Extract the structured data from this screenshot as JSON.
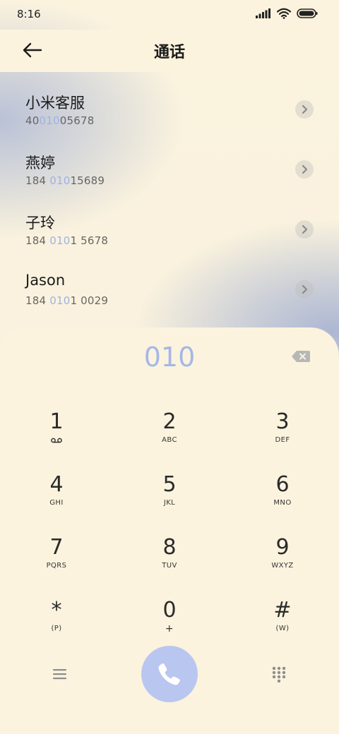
{
  "status_bar": {
    "time": "8:16",
    "icons": [
      "signal-icon",
      "wifi-icon",
      "battery-icon"
    ]
  },
  "header": {
    "title": "通话",
    "back_icon": "arrow-left-icon"
  },
  "contacts": [
    {
      "name": "小米客服",
      "number_pre": "40",
      "number_match": "010",
      "number_post": "05678"
    },
    {
      "name": "燕婷",
      "number_pre": "184 ",
      "number_match": "010",
      "number_post": "15689"
    },
    {
      "name": "子玲",
      "number_pre": "184 ",
      "number_match": "010",
      "number_post": "1 5678"
    },
    {
      "name": "Jason",
      "number_pre": "184 ",
      "number_match": "010",
      "number_post": "1 0029"
    }
  ],
  "dialer": {
    "digits": "010",
    "keys": [
      {
        "digit": "1",
        "letters": ""
      },
      {
        "digit": "2",
        "letters": "ABC"
      },
      {
        "digit": "3",
        "letters": "DEF"
      },
      {
        "digit": "4",
        "letters": "GHI"
      },
      {
        "digit": "5",
        "letters": "JKL"
      },
      {
        "digit": "6",
        "letters": "MNO"
      },
      {
        "digit": "7",
        "letters": "PQRS"
      },
      {
        "digit": "8",
        "letters": "TUV"
      },
      {
        "digit": "9",
        "letters": "WXYZ"
      },
      {
        "digit": "*",
        "letters": "(P)"
      },
      {
        "digit": "0",
        "letters": "+"
      },
      {
        "digit": "#",
        "letters": "(W)"
      }
    ]
  },
  "colors": {
    "accent": "#a6b7e5",
    "call_button": "#b9c6f0",
    "background": "#fbf3de"
  }
}
